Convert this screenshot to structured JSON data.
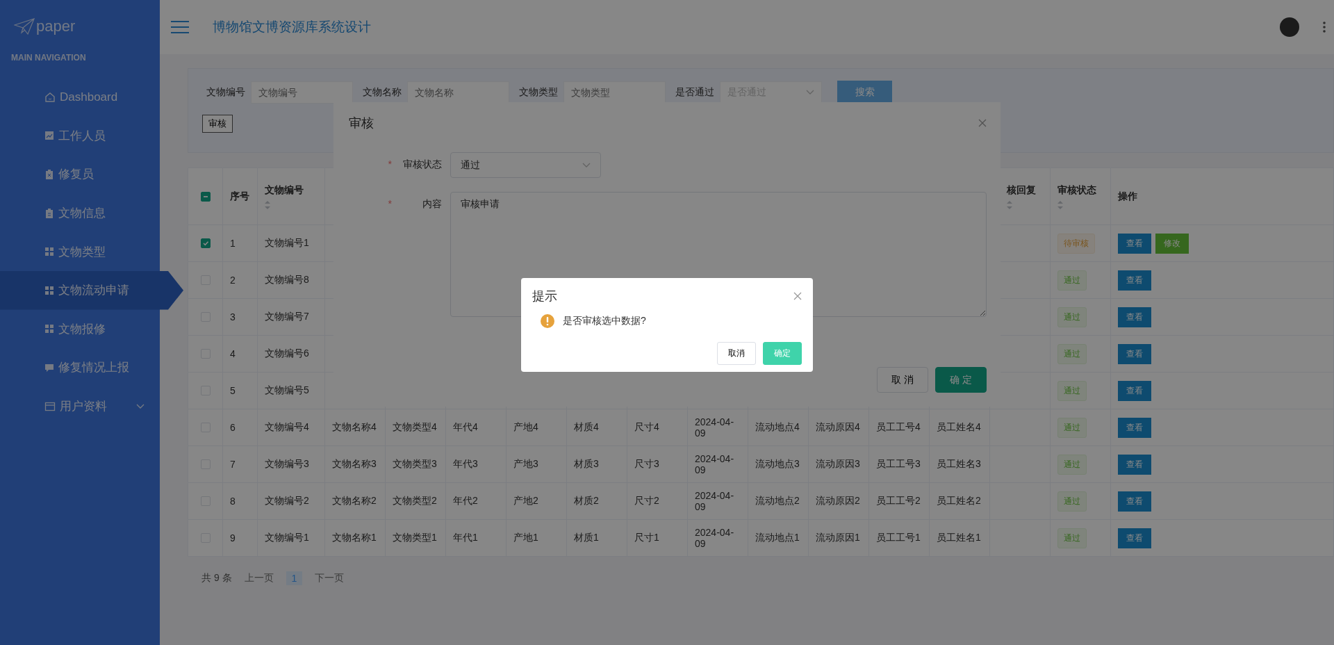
{
  "sidebar": {
    "logo": "paper",
    "section": "MAIN NAVIGATION",
    "items": [
      {
        "label": "Dashboard",
        "selected": false
      },
      {
        "label": "工作人员",
        "selected": false
      },
      {
        "label": "修复员",
        "selected": false
      },
      {
        "label": "文物信息",
        "selected": false
      },
      {
        "label": "文物类型",
        "selected": false
      },
      {
        "label": "文物流动申请",
        "selected": true
      },
      {
        "label": "文物报修",
        "selected": false
      },
      {
        "label": "修复情况上报",
        "selected": false
      },
      {
        "label": "用户资料",
        "selected": false,
        "expanded": false
      }
    ]
  },
  "header": {
    "title": "博物馆文博资源库系统设计"
  },
  "search": {
    "fields": [
      {
        "label": "文物编号",
        "placeholder": "文物编号",
        "kind": "input"
      },
      {
        "label": "文物名称",
        "placeholder": "文物名称",
        "kind": "input"
      },
      {
        "label": "文物类型",
        "placeholder": "文物类型",
        "kind": "input"
      },
      {
        "label": "是否通过",
        "placeholder": "是否通过",
        "kind": "select"
      }
    ],
    "button": "搜索",
    "toolbar_button": "审核"
  },
  "table": {
    "header_checkbox": {
      "indeterminate": true
    },
    "columns_left": [
      {
        "label": "序号",
        "sortable": false
      },
      {
        "label": "文物编号",
        "sortable": true
      }
    ],
    "columns_right": [
      {
        "label": "核回复",
        "sortable": true
      },
      {
        "label": "审核状态",
        "sortable": true
      },
      {
        "label": "操作",
        "sortable": false
      }
    ],
    "rows": [
      {
        "selected": true,
        "index": "1",
        "code": "文物编号1",
        "status": {
          "label": "待审核",
          "kind": "pending"
        },
        "actions": [
          {
            "label": "查看",
            "kind": "view"
          },
          {
            "label": "修改",
            "kind": "edit"
          }
        ]
      },
      {
        "selected": false,
        "index": "2",
        "code": "文物编号8",
        "status": {
          "label": "通过",
          "kind": "pass"
        },
        "actions": [
          {
            "label": "查看",
            "kind": "view"
          }
        ]
      },
      {
        "selected": false,
        "index": "3",
        "code": "文物编号7",
        "status": {
          "label": "通过",
          "kind": "pass"
        },
        "actions": [
          {
            "label": "查看",
            "kind": "view"
          }
        ]
      },
      {
        "selected": false,
        "index": "4",
        "code": "文物编号6",
        "status": {
          "label": "通过",
          "kind": "pass"
        },
        "actions": [
          {
            "label": "查看",
            "kind": "view"
          }
        ]
      },
      {
        "selected": false,
        "index": "5",
        "code": "文物编号5",
        "status": {
          "label": "通过",
          "kind": "pass"
        },
        "actions": [
          {
            "label": "查看",
            "kind": "view"
          }
        ]
      },
      {
        "selected": false,
        "index": "6",
        "code": "文物编号4",
        "cells": [
          "文物名称4",
          "文物类型4",
          "年代4",
          "产地4",
          "材质4",
          "尺寸4",
          "2024-04-09",
          "流动地点4",
          "流动原因4",
          "员工工号4",
          "员工姓名4"
        ],
        "status": {
          "label": "通过",
          "kind": "pass"
        },
        "actions": [
          {
            "label": "查看",
            "kind": "view"
          }
        ]
      },
      {
        "selected": false,
        "index": "7",
        "code": "文物编号3",
        "cells": [
          "文物名称3",
          "文物类型3",
          "年代3",
          "产地3",
          "材质3",
          "尺寸3",
          "2024-04-09",
          "流动地点3",
          "流动原因3",
          "员工工号3",
          "员工姓名3"
        ],
        "status": {
          "label": "通过",
          "kind": "pass"
        },
        "actions": [
          {
            "label": "查看",
            "kind": "view"
          }
        ]
      },
      {
        "selected": false,
        "index": "8",
        "code": "文物编号2",
        "cells": [
          "文物名称2",
          "文物类型2",
          "年代2",
          "产地2",
          "材质2",
          "尺寸2",
          "2024-04-09",
          "流动地点2",
          "流动原因2",
          "员工工号2",
          "员工姓名2"
        ],
        "status": {
          "label": "通过",
          "kind": "pass"
        },
        "actions": [
          {
            "label": "查看",
            "kind": "view"
          }
        ]
      },
      {
        "selected": false,
        "index": "9",
        "code": "文物编号1",
        "cells": [
          "文物名称1",
          "文物类型1",
          "年代1",
          "产地1",
          "材质1",
          "尺寸1",
          "2024-04-09",
          "流动地点1",
          "流动原因1",
          "员工工号1",
          "员工姓名1"
        ],
        "status": {
          "label": "通过",
          "kind": "pass"
        },
        "actions": [
          {
            "label": "查看",
            "kind": "view"
          }
        ]
      }
    ]
  },
  "pagination": {
    "total": "共 9 条",
    "prev": "上一页",
    "pages": [
      {
        "label": "1",
        "selected": true
      }
    ],
    "next": "下一页"
  },
  "review_dialog": {
    "title": "审核",
    "fields": [
      {
        "label": "审核状态",
        "required_mark": "*",
        "kind": "select",
        "value": "通过"
      },
      {
        "label": "内容",
        "required_mark": "*",
        "kind": "textarea",
        "value": "审核申请"
      }
    ],
    "buttons": [
      {
        "label": "取 消",
        "kind": "default"
      },
      {
        "label": "确 定",
        "kind": "primary"
      }
    ]
  },
  "confirm_dialog": {
    "title": "提示",
    "message": "是否审核选中数据?",
    "buttons": [
      {
        "label": "取消",
        "kind": "default"
      },
      {
        "label": "确定",
        "kind": "primary"
      }
    ]
  }
}
